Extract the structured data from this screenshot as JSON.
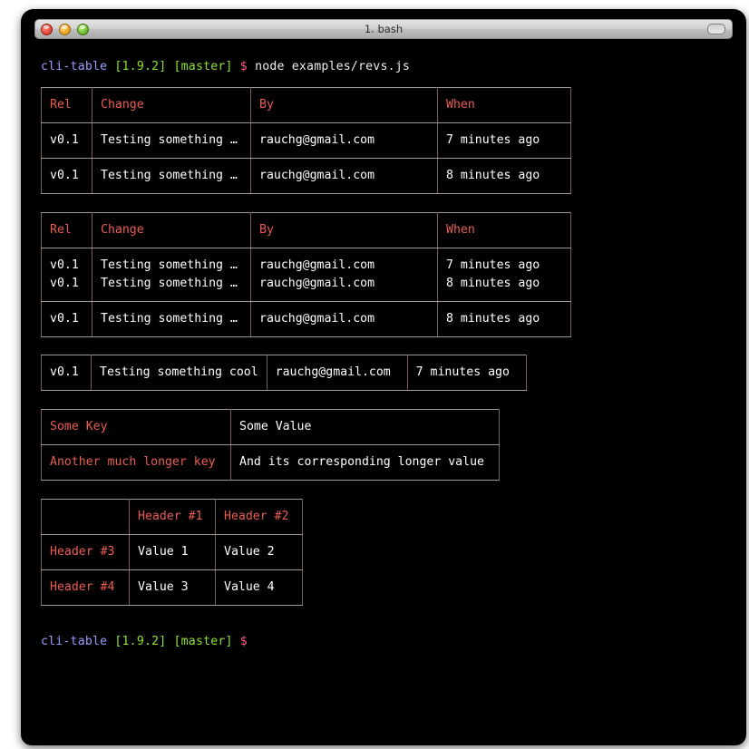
{
  "window": {
    "title": "1. bash",
    "controls": {
      "close": "close",
      "minimize": "minimize",
      "zoom": "zoom"
    },
    "resize_grip": "resize-grip"
  },
  "colors": {
    "background": "#000000",
    "foreground": "#e5e5e5",
    "header_red": "#ea5c52",
    "prompt_host": "#9d9dff",
    "prompt_green": "#8ae234",
    "prompt_dollar": "#ff5f87",
    "border_gray": "#9a9a9a",
    "border_vertical": "#7a5b58"
  },
  "prompt_top": {
    "host": "cli-table",
    "version": "[1.9.2]",
    "branch": "[master]",
    "symbol": "$",
    "command": "node examples/revs.js"
  },
  "prompt_bottom": {
    "host": "cli-table",
    "version": "[1.9.2]",
    "branch": "[master]",
    "symbol": "$",
    "command": ""
  },
  "tables": [
    {
      "id": "table-1",
      "name": "revs-table-basic",
      "headers": [
        "Rel",
        "Change",
        "By",
        "When"
      ],
      "rows": [
        [
          "v0.1",
          "Testing something …",
          "rauchg@gmail.com",
          "7 minutes ago"
        ],
        [
          "v0.1",
          "Testing something …",
          "rauchg@gmail.com",
          "8 minutes ago"
        ]
      ]
    },
    {
      "id": "table-2",
      "name": "revs-table-compact",
      "headers": [
        "Rel",
        "Change",
        "By",
        "When"
      ],
      "multi_row": [
        [
          "v0.1",
          "Testing something …",
          "rauchg@gmail.com",
          "7 minutes ago"
        ],
        [
          "v0.1",
          "Testing something …",
          "rauchg@gmail.com",
          "8 minutes ago"
        ]
      ],
      "rows": [
        [
          "v0.1",
          "Testing something …",
          "rauchg@gmail.com",
          "8 minutes ago"
        ]
      ]
    },
    {
      "id": "table-3",
      "name": "revs-table-headerless",
      "rows": [
        [
          "v0.1",
          "Testing something cool",
          "rauchg@gmail.com",
          "7 minutes ago"
        ]
      ]
    },
    {
      "id": "table-4",
      "name": "key-value-table",
      "rows": [
        [
          "Some Key",
          "Some Value"
        ],
        [
          "Another much longer key",
          "And its corresponding longer value"
        ]
      ]
    },
    {
      "id": "table-5",
      "name": "cross-table",
      "corner": "",
      "col_headers": [
        "Header #1",
        "Header #2"
      ],
      "rows": [
        [
          "Header #3",
          "Value 1",
          "Value 2"
        ],
        [
          "Header #4",
          "Value 3",
          "Value 4"
        ]
      ]
    }
  ]
}
